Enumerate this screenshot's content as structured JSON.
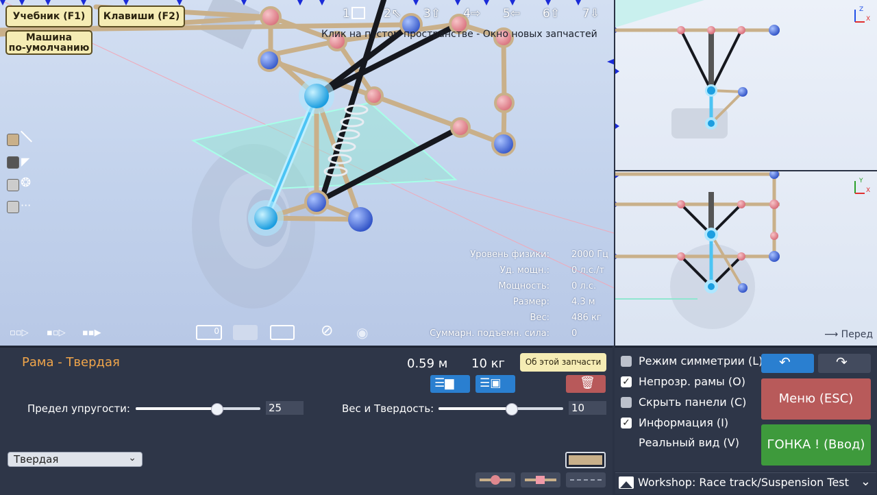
{
  "toolbar": {
    "tutorial_button": "Учебник (F1)",
    "keys_button": "Клавиши (F2)",
    "default_car_button_line1": "Машина",
    "default_car_button_line2": "по-умолчанию",
    "tools": [
      {
        "num": "1",
        "icon": "rotate-icon"
      },
      {
        "num": "2",
        "icon": "arrow-up-left-icon"
      },
      {
        "num": "3",
        "icon": "arrow-up-icon"
      },
      {
        "num": "4",
        "icon": "arrow-right-icon"
      },
      {
        "num": "5",
        "icon": "arrow-left-icon"
      },
      {
        "num": "6",
        "icon": "arrow-up-icon"
      },
      {
        "num": "7",
        "icon": "arrow-down-icon"
      }
    ],
    "hint_text": "Клик на пустом пространстве - Окно новых запчастей"
  },
  "info": {
    "physics_label": "Уровень физики:",
    "physics_value": "2000 Гц",
    "power_weight_label": "Уд. мощн.:",
    "power_weight_value": "0 л.с./т",
    "power_label": "Мощность:",
    "power_value": "0 л.с.",
    "size_label": "Размер:",
    "size_value": "4.3 м",
    "weight_label": "Вес:",
    "weight_value": "486 кг",
    "lift_label": "Суммарн. подъемн. сила:",
    "lift_value": "0"
  },
  "side_view": {
    "front_label": "Перед"
  },
  "part_panel": {
    "part_name": "Рама - Твердая",
    "length": "0.59 м",
    "mass": "10 кг",
    "about_button": "Об этой запчасти",
    "elasticity_label": "Предел упругости:",
    "elasticity_value": "25",
    "elasticity_fraction": 0.65,
    "weight_hardness_label": "Вес и Твердость:",
    "weight_hardness_value": "10",
    "weight_hardness_fraction": 0.58,
    "material_selected": "Твердая"
  },
  "right_panel": {
    "symmetry_label": "Режим симметрии (L)",
    "symmetry_checked": false,
    "opaque_label": "Непрозр. рамы (O)",
    "opaque_checked": true,
    "hide_panels_label": "Скрыть панели (C)",
    "hide_panels_checked": false,
    "info_label": "Информация (I)",
    "info_checked": true,
    "real_view_label": "Реальный вид (V)",
    "menu_button": "Меню (ESC)",
    "race_button": "ГОНКА ! (Ввод)",
    "workshop_label": "Workshop:  Race track/Suspension Test"
  },
  "colors": {
    "accent_orange": "#f0a54a",
    "menu_red": "#b85a5a",
    "race_green": "#3e9a3c",
    "frame_tan": "#c9b08a",
    "node_pink": "#e0888f",
    "node_blue": "#4f78d8",
    "selected_cyan": "#35b8f0"
  }
}
